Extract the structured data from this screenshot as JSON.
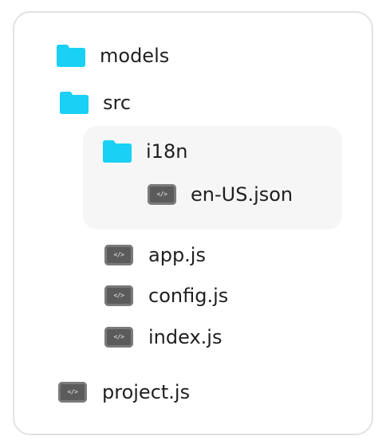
{
  "colors": {
    "folder": "#1ad0f5",
    "file_icon": "#5b5b5b",
    "file_icon_border": "#7a7a7a",
    "panel_border": "#e2e2e2",
    "group_bg": "#f6f6f6",
    "text": "#1f1f1f"
  },
  "tree": {
    "models": {
      "label": "models",
      "icon": "folder-icon"
    },
    "src": {
      "label": "src",
      "icon": "folder-icon",
      "i18n": {
        "label": "i18n",
        "icon": "folder-icon",
        "en_us": {
          "label": "en-US.json",
          "icon": "code-file-icon",
          "glyph": "</>"
        }
      },
      "app": {
        "label": "app.js",
        "icon": "code-file-icon",
        "glyph": "</>"
      },
      "config": {
        "label": "config.js",
        "icon": "code-file-icon",
        "glyph": "</>"
      },
      "index": {
        "label": "index.js",
        "icon": "code-file-icon",
        "glyph": "</>"
      }
    },
    "project": {
      "label": "project.js",
      "icon": "code-file-icon",
      "glyph": "</>"
    }
  }
}
